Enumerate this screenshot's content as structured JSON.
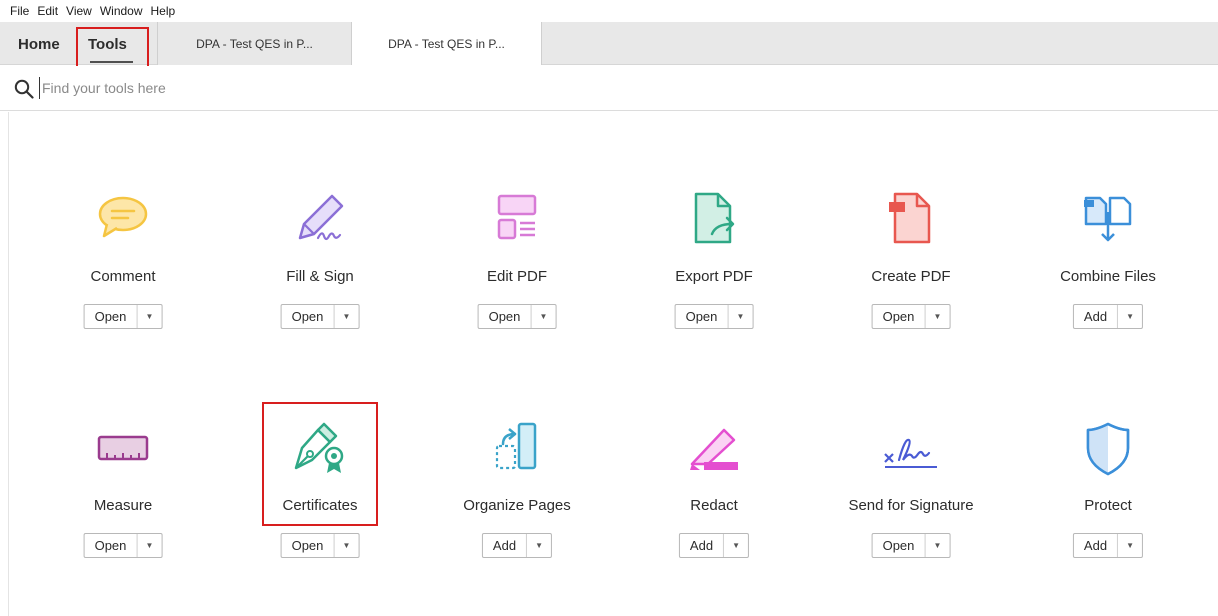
{
  "menu": [
    "File",
    "Edit",
    "View",
    "Window",
    "Help"
  ],
  "tabs": {
    "home": "Home",
    "tools": "Tools",
    "documents": [
      "DPA - Test QES in P...",
      "DPA - Test QES in P..."
    ]
  },
  "search": {
    "placeholder": "Find your tools here"
  },
  "tools_row1": [
    {
      "name": "Comment",
      "action": "Open"
    },
    {
      "name": "Fill & Sign",
      "action": "Open"
    },
    {
      "name": "Edit PDF",
      "action": "Open"
    },
    {
      "name": "Export PDF",
      "action": "Open"
    },
    {
      "name": "Create PDF",
      "action": "Open"
    },
    {
      "name": "Combine Files",
      "action": "Add"
    }
  ],
  "tools_row2": [
    {
      "name": "Measure",
      "action": "Open"
    },
    {
      "name": "Certificates",
      "action": "Open"
    },
    {
      "name": "Organize Pages",
      "action": "Add"
    },
    {
      "name": "Redact",
      "action": "Add"
    },
    {
      "name": "Send for Signature",
      "action": "Open"
    },
    {
      "name": "Protect",
      "action": "Add"
    }
  ],
  "colors": {
    "highlight": "#d81e1e",
    "comment": "#f5c542",
    "fill_sign": "#8b6fd6",
    "edit_pdf": "#d77ad6",
    "export_pdf": "#2fa886",
    "create_pdf": "#e8574f",
    "combine": "#3b8fd9",
    "measure": "#9a3b8e",
    "certificates": "#2fa886",
    "organize": "#3aa3c9",
    "redact": "#e44fd0",
    "send_sig": "#4a5bd4",
    "protect": "#3b8fd9"
  }
}
